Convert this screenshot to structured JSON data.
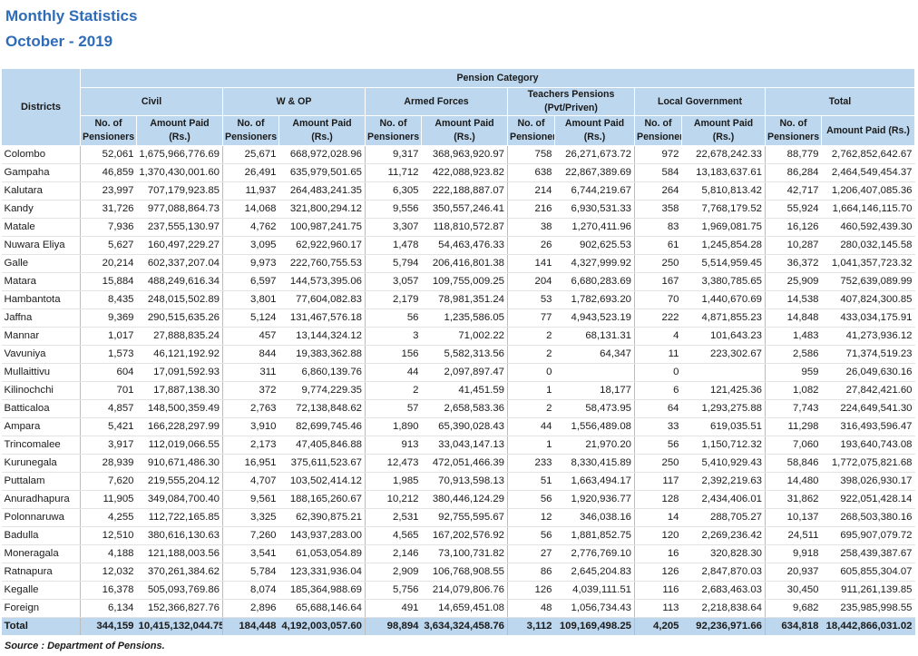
{
  "title": {
    "line1": "Monthly Statistics",
    "line2": "October - 2019"
  },
  "headers": {
    "districts": "Districts",
    "pension_category": "Pension Category",
    "groups": [
      "Civil",
      "W & OP",
      "Armed Forces",
      "Teachers Pensions (Pvt/Priven)",
      "Local Government",
      "Total"
    ],
    "no_of_pensioners": "No. of Pensioners",
    "amount_paid": "Amount Paid (Rs.)"
  },
  "rows": [
    {
      "district": "Colombo",
      "values": [
        "52,061",
        "1,675,966,776.69",
        "25,671",
        "668,972,028.96",
        "9,317",
        "368,963,920.97",
        "758",
        "26,271,673.72",
        "972",
        "22,678,242.33",
        "88,779",
        "2,762,852,642.67"
      ]
    },
    {
      "district": "Gampaha",
      "values": [
        "46,859",
        "1,370,430,001.60",
        "26,491",
        "635,979,501.65",
        "11,712",
        "422,088,923.82",
        "638",
        "22,867,389.69",
        "584",
        "13,183,637.61",
        "86,284",
        "2,464,549,454.37"
      ]
    },
    {
      "district": "Kalutara",
      "values": [
        "23,997",
        "707,179,923.85",
        "11,937",
        "264,483,241.35",
        "6,305",
        "222,188,887.07",
        "214",
        "6,744,219.67",
        "264",
        "5,810,813.42",
        "42,717",
        "1,206,407,085.36"
      ]
    },
    {
      "district": "Kandy",
      "values": [
        "31,726",
        "977,088,864.73",
        "14,068",
        "321,800,294.12",
        "9,556",
        "350,557,246.41",
        "216",
        "6,930,531.33",
        "358",
        "7,768,179.52",
        "55,924",
        "1,664,146,115.70"
      ]
    },
    {
      "district": "Matale",
      "values": [
        "7,936",
        "237,555,130.97",
        "4,762",
        "100,987,241.75",
        "3,307",
        "118,810,572.87",
        "38",
        "1,270,411.96",
        "83",
        "1,969,081.75",
        "16,126",
        "460,592,439.30"
      ]
    },
    {
      "district": "Nuwara Eliya",
      "values": [
        "5,627",
        "160,497,229.27",
        "3,095",
        "62,922,960.17",
        "1,478",
        "54,463,476.33",
        "26",
        "902,625.53",
        "61",
        "1,245,854.28",
        "10,287",
        "280,032,145.58"
      ]
    },
    {
      "district": "Galle",
      "values": [
        "20,214",
        "602,337,207.04",
        "9,973",
        "222,760,755.53",
        "5,794",
        "206,416,801.38",
        "141",
        "4,327,999.92",
        "250",
        "5,514,959.45",
        "36,372",
        "1,041,357,723.32"
      ]
    },
    {
      "district": "Matara",
      "values": [
        "15,884",
        "488,249,616.34",
        "6,597",
        "144,573,395.06",
        "3,057",
        "109,755,009.25",
        "204",
        "6,680,283.69",
        "167",
        "3,380,785.65",
        "25,909",
        "752,639,089.99"
      ]
    },
    {
      "district": "Hambantota",
      "values": [
        "8,435",
        "248,015,502.89",
        "3,801",
        "77,604,082.83",
        "2,179",
        "78,981,351.24",
        "53",
        "1,782,693.20",
        "70",
        "1,440,670.69",
        "14,538",
        "407,824,300.85"
      ]
    },
    {
      "district": "Jaffna",
      "values": [
        "9,369",
        "290,515,635.26",
        "5,124",
        "131,467,576.18",
        "56",
        "1,235,586.05",
        "77",
        "4,943,523.19",
        "222",
        "4,871,855.23",
        "14,848",
        "433,034,175.91"
      ]
    },
    {
      "district": "Mannar",
      "values": [
        "1,017",
        "27,888,835.24",
        "457",
        "13,144,324.12",
        "3",
        "71,002.22",
        "2",
        "68,131.31",
        "4",
        "101,643.23",
        "1,483",
        "41,273,936.12"
      ]
    },
    {
      "district": "Vavuniya",
      "values": [
        "1,573",
        "46,121,192.92",
        "844",
        "19,383,362.88",
        "156",
        "5,582,313.56",
        "2",
        "64,347",
        "11",
        "223,302.67",
        "2,586",
        "71,374,519.23"
      ]
    },
    {
      "district": "Mullaittivu",
      "values": [
        "604",
        "17,091,592.93",
        "311",
        "6,860,139.76",
        "44",
        "2,097,897.47",
        "0",
        "",
        "0",
        "",
        "959",
        "26,049,630.16"
      ]
    },
    {
      "district": "Kilinochchi",
      "values": [
        "701",
        "17,887,138.30",
        "372",
        "9,774,229.35",
        "2",
        "41,451.59",
        "1",
        "18,177",
        "6",
        "121,425.36",
        "1,082",
        "27,842,421.60"
      ]
    },
    {
      "district": "Batticaloa",
      "values": [
        "4,857",
        "148,500,359.49",
        "2,763",
        "72,138,848.62",
        "57",
        "2,658,583.36",
        "2",
        "58,473.95",
        "64",
        "1,293,275.88",
        "7,743",
        "224,649,541.30"
      ]
    },
    {
      "district": "Ampara",
      "values": [
        "5,421",
        "166,228,297.99",
        "3,910",
        "82,699,745.46",
        "1,890",
        "65,390,028.43",
        "44",
        "1,556,489.08",
        "33",
        "619,035.51",
        "11,298",
        "316,493,596.47"
      ]
    },
    {
      "district": "Trincomalee",
      "values": [
        "3,917",
        "112,019,066.55",
        "2,173",
        "47,405,846.88",
        "913",
        "33,043,147.13",
        "1",
        "21,970.20",
        "56",
        "1,150,712.32",
        "7,060",
        "193,640,743.08"
      ]
    },
    {
      "district": "Kurunegala",
      "values": [
        "28,939",
        "910,671,486.30",
        "16,951",
        "375,611,523.67",
        "12,473",
        "472,051,466.39",
        "233",
        "8,330,415.89",
        "250",
        "5,410,929.43",
        "58,846",
        "1,772,075,821.68"
      ]
    },
    {
      "district": "Puttalam",
      "values": [
        "7,620",
        "219,555,204.12",
        "4,707",
        "103,502,414.12",
        "1,985",
        "70,913,598.13",
        "51",
        "1,663,494.17",
        "117",
        "2,392,219.63",
        "14,480",
        "398,026,930.17"
      ]
    },
    {
      "district": "Anuradhapura",
      "values": [
        "11,905",
        "349,084,700.40",
        "9,561",
        "188,165,260.67",
        "10,212",
        "380,446,124.29",
        "56",
        "1,920,936.77",
        "128",
        "2,434,406.01",
        "31,862",
        "922,051,428.14"
      ]
    },
    {
      "district": "Polonnaruwa",
      "values": [
        "4,255",
        "112,722,165.85",
        "3,325",
        "62,390,875.21",
        "2,531",
        "92,755,595.67",
        "12",
        "346,038.16",
        "14",
        "288,705.27",
        "10,137",
        "268,503,380.16"
      ]
    },
    {
      "district": "Badulla",
      "values": [
        "12,510",
        "380,616,130.63",
        "7,260",
        "143,937,283.00",
        "4,565",
        "167,202,576.92",
        "56",
        "1,881,852.75",
        "120",
        "2,269,236.42",
        "24,511",
        "695,907,079.72"
      ]
    },
    {
      "district": "Moneragala",
      "values": [
        "4,188",
        "121,188,003.56",
        "3,541",
        "61,053,054.89",
        "2,146",
        "73,100,731.82",
        "27",
        "2,776,769.10",
        "16",
        "320,828.30",
        "9,918",
        "258,439,387.67"
      ]
    },
    {
      "district": "Ratnapura",
      "values": [
        "12,032",
        "370,261,384.62",
        "5,784",
        "123,331,936.04",
        "2,909",
        "106,768,908.55",
        "86",
        "2,645,204.83",
        "126",
        "2,847,870.03",
        "20,937",
        "605,855,304.07"
      ]
    },
    {
      "district": "Kegalle",
      "values": [
        "16,378",
        "505,093,769.86",
        "8,074",
        "185,364,988.69",
        "5,756",
        "214,079,806.76",
        "126",
        "4,039,111.51",
        "116",
        "2,683,463.03",
        "30,450",
        "911,261,139.85"
      ]
    },
    {
      "district": "Foreign",
      "values": [
        "6,134",
        "152,366,827.76",
        "2,896",
        "65,688,146.64",
        "491",
        "14,659,451.08",
        "48",
        "1,056,734.43",
        "113",
        "2,218,838.64",
        "9,682",
        "235,985,998.55"
      ]
    }
  ],
  "total": {
    "label": "Total",
    "values": [
      "344,159",
      "10,415,132,044.75",
      "184,448",
      "4,192,003,057.60",
      "98,894",
      "3,634,324,458.76",
      "3,112",
      "109,169,498.25",
      "4,205",
      "92,236,971.66",
      "634,818",
      "18,442,866,031.02"
    ]
  },
  "source": "Source : Department of Pensions.",
  "colors": {
    "title": "#2e6cb8",
    "header_fill": "#bdd7ee"
  }
}
